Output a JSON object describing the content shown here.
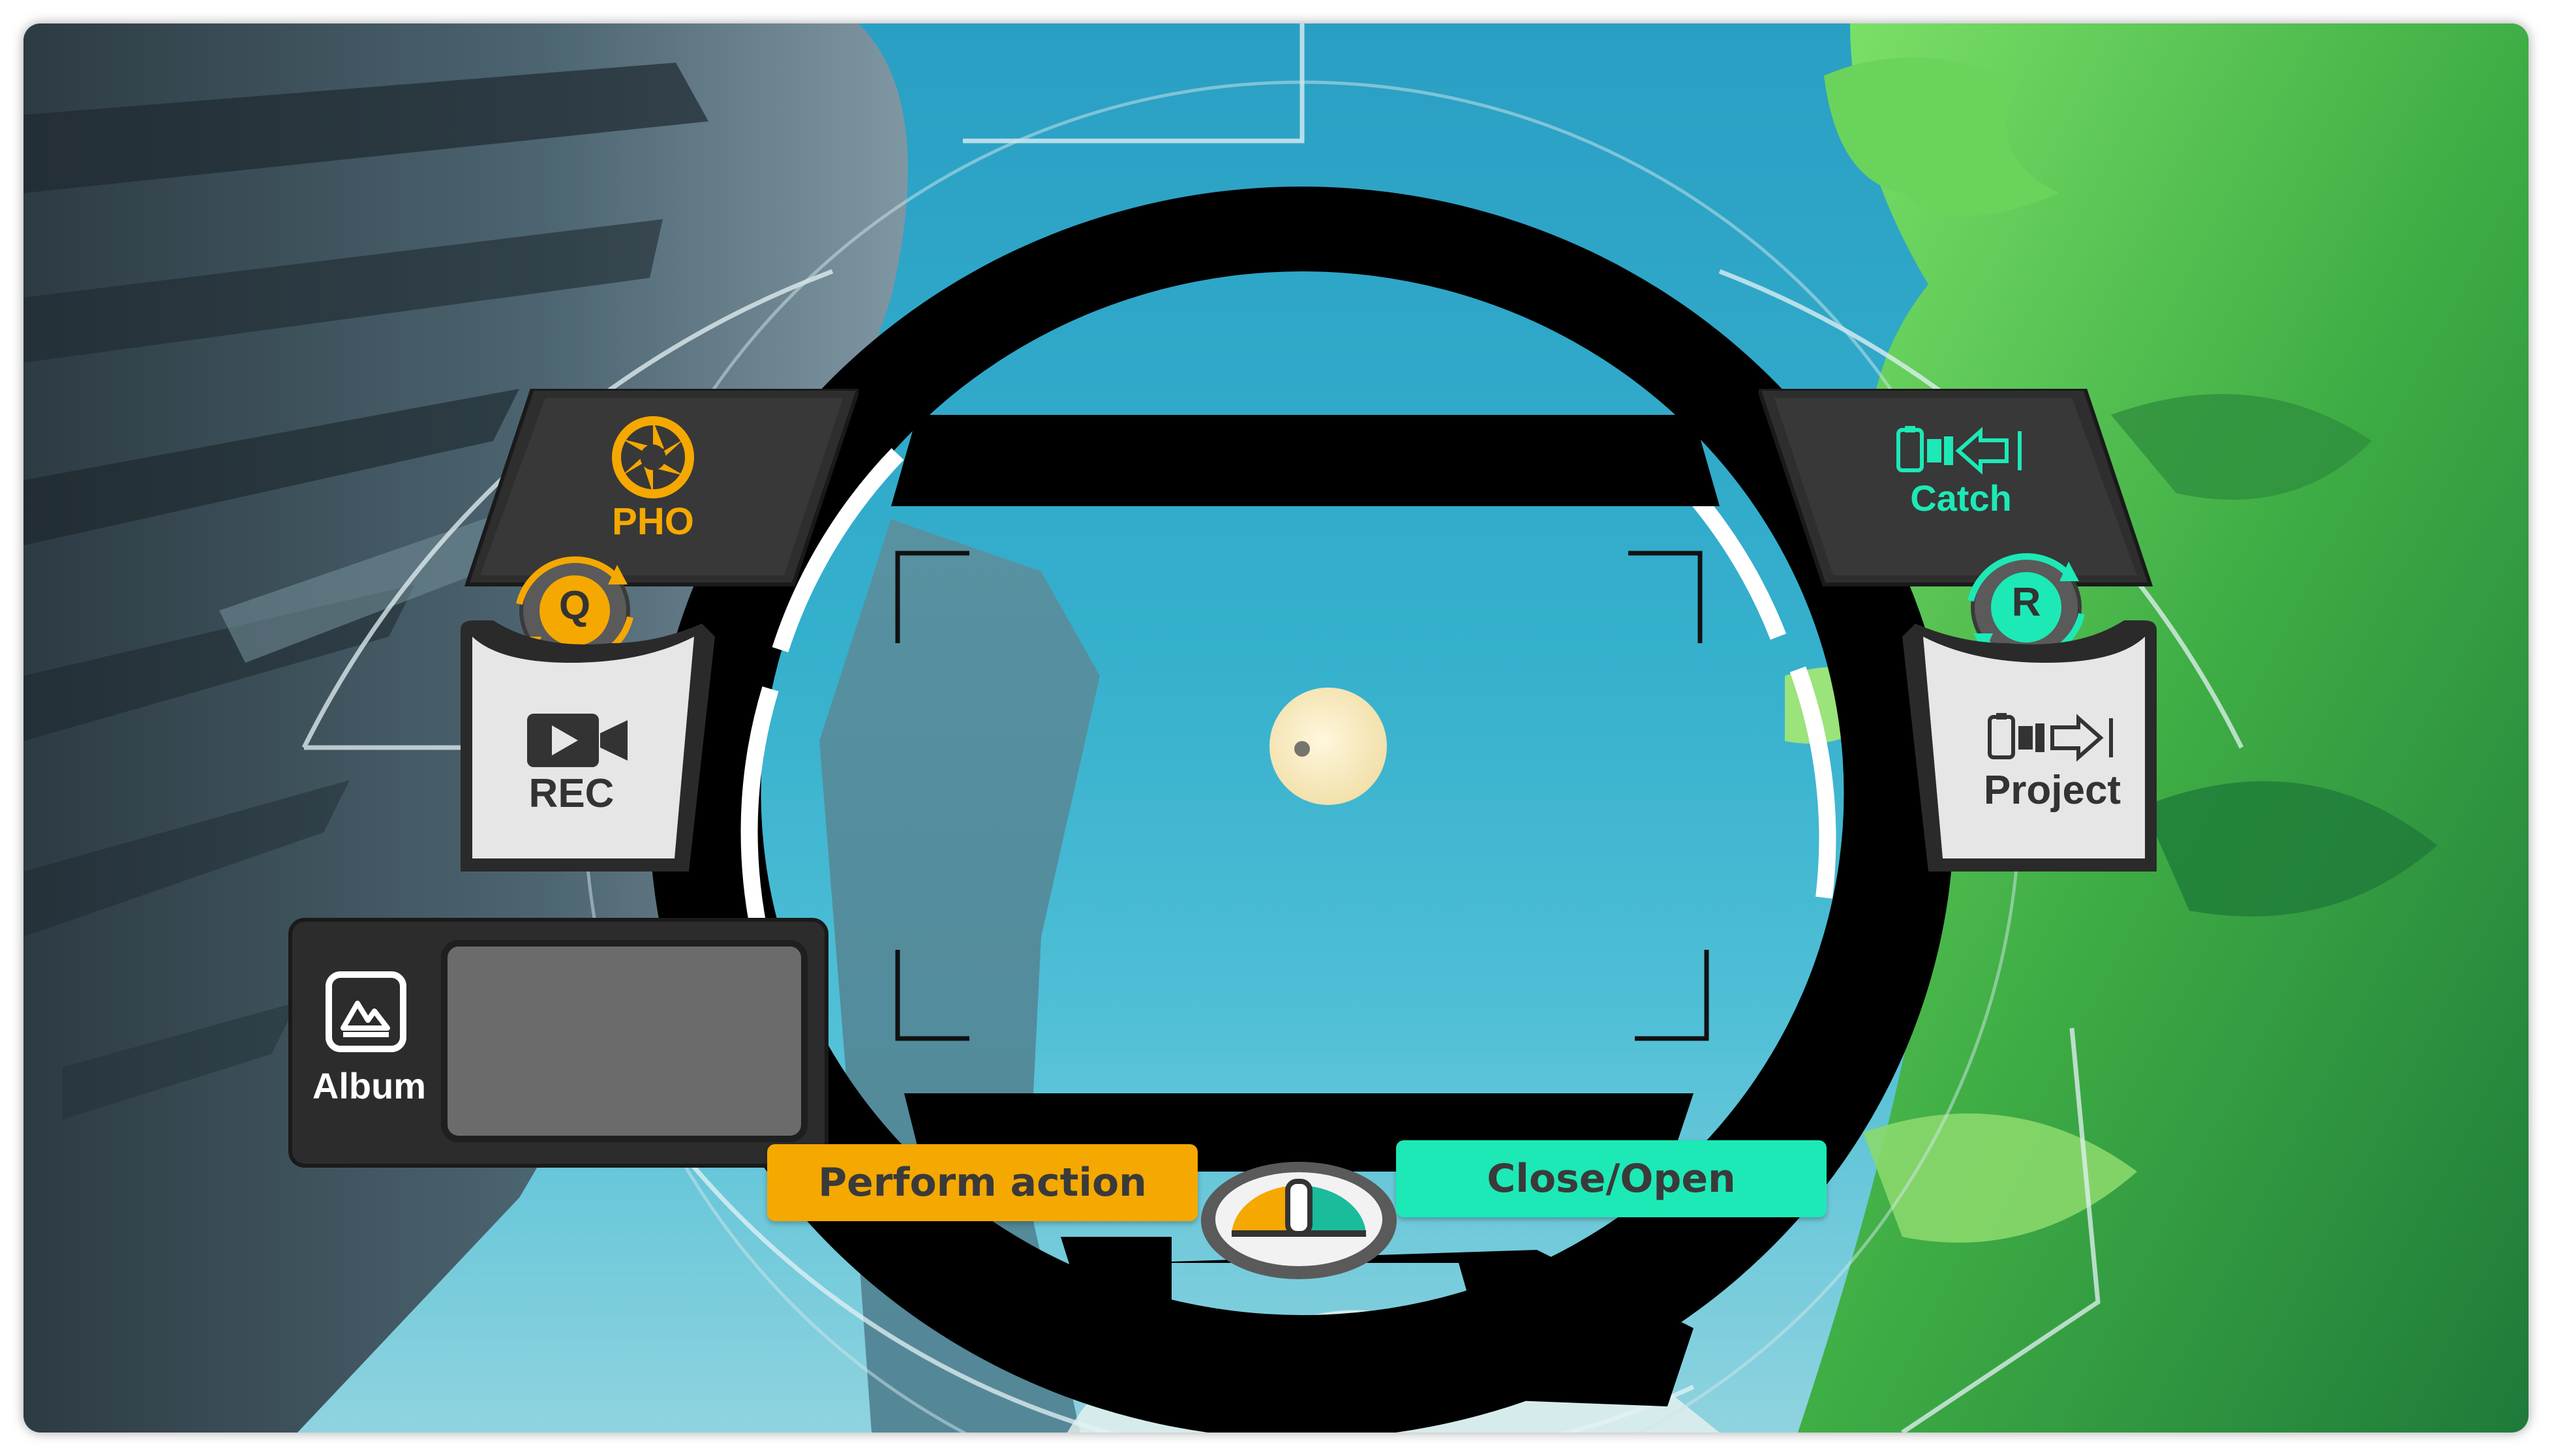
{
  "hud": {
    "photo_mode": {
      "label": "PHO",
      "key": "Q",
      "icon": "aperture-icon",
      "color": "#f5a800"
    },
    "record_mode": {
      "label": "REC",
      "icon": "video-camera-icon"
    },
    "catch_mode": {
      "label": "Catch",
      "key": "R",
      "icon": "catch-icon",
      "color": "#1de9b6"
    },
    "project_mode": {
      "label": "Project",
      "icon": "project-icon"
    },
    "album": {
      "label": "Album",
      "icon": "album-icon"
    },
    "prompts": {
      "perform_action": {
        "label": "Perform action",
        "color": "#f5a800"
      },
      "close_open": {
        "label": "Close/Open",
        "color": "#1de9b6"
      }
    },
    "indicator": {
      "icon": "gauge-icon"
    }
  }
}
